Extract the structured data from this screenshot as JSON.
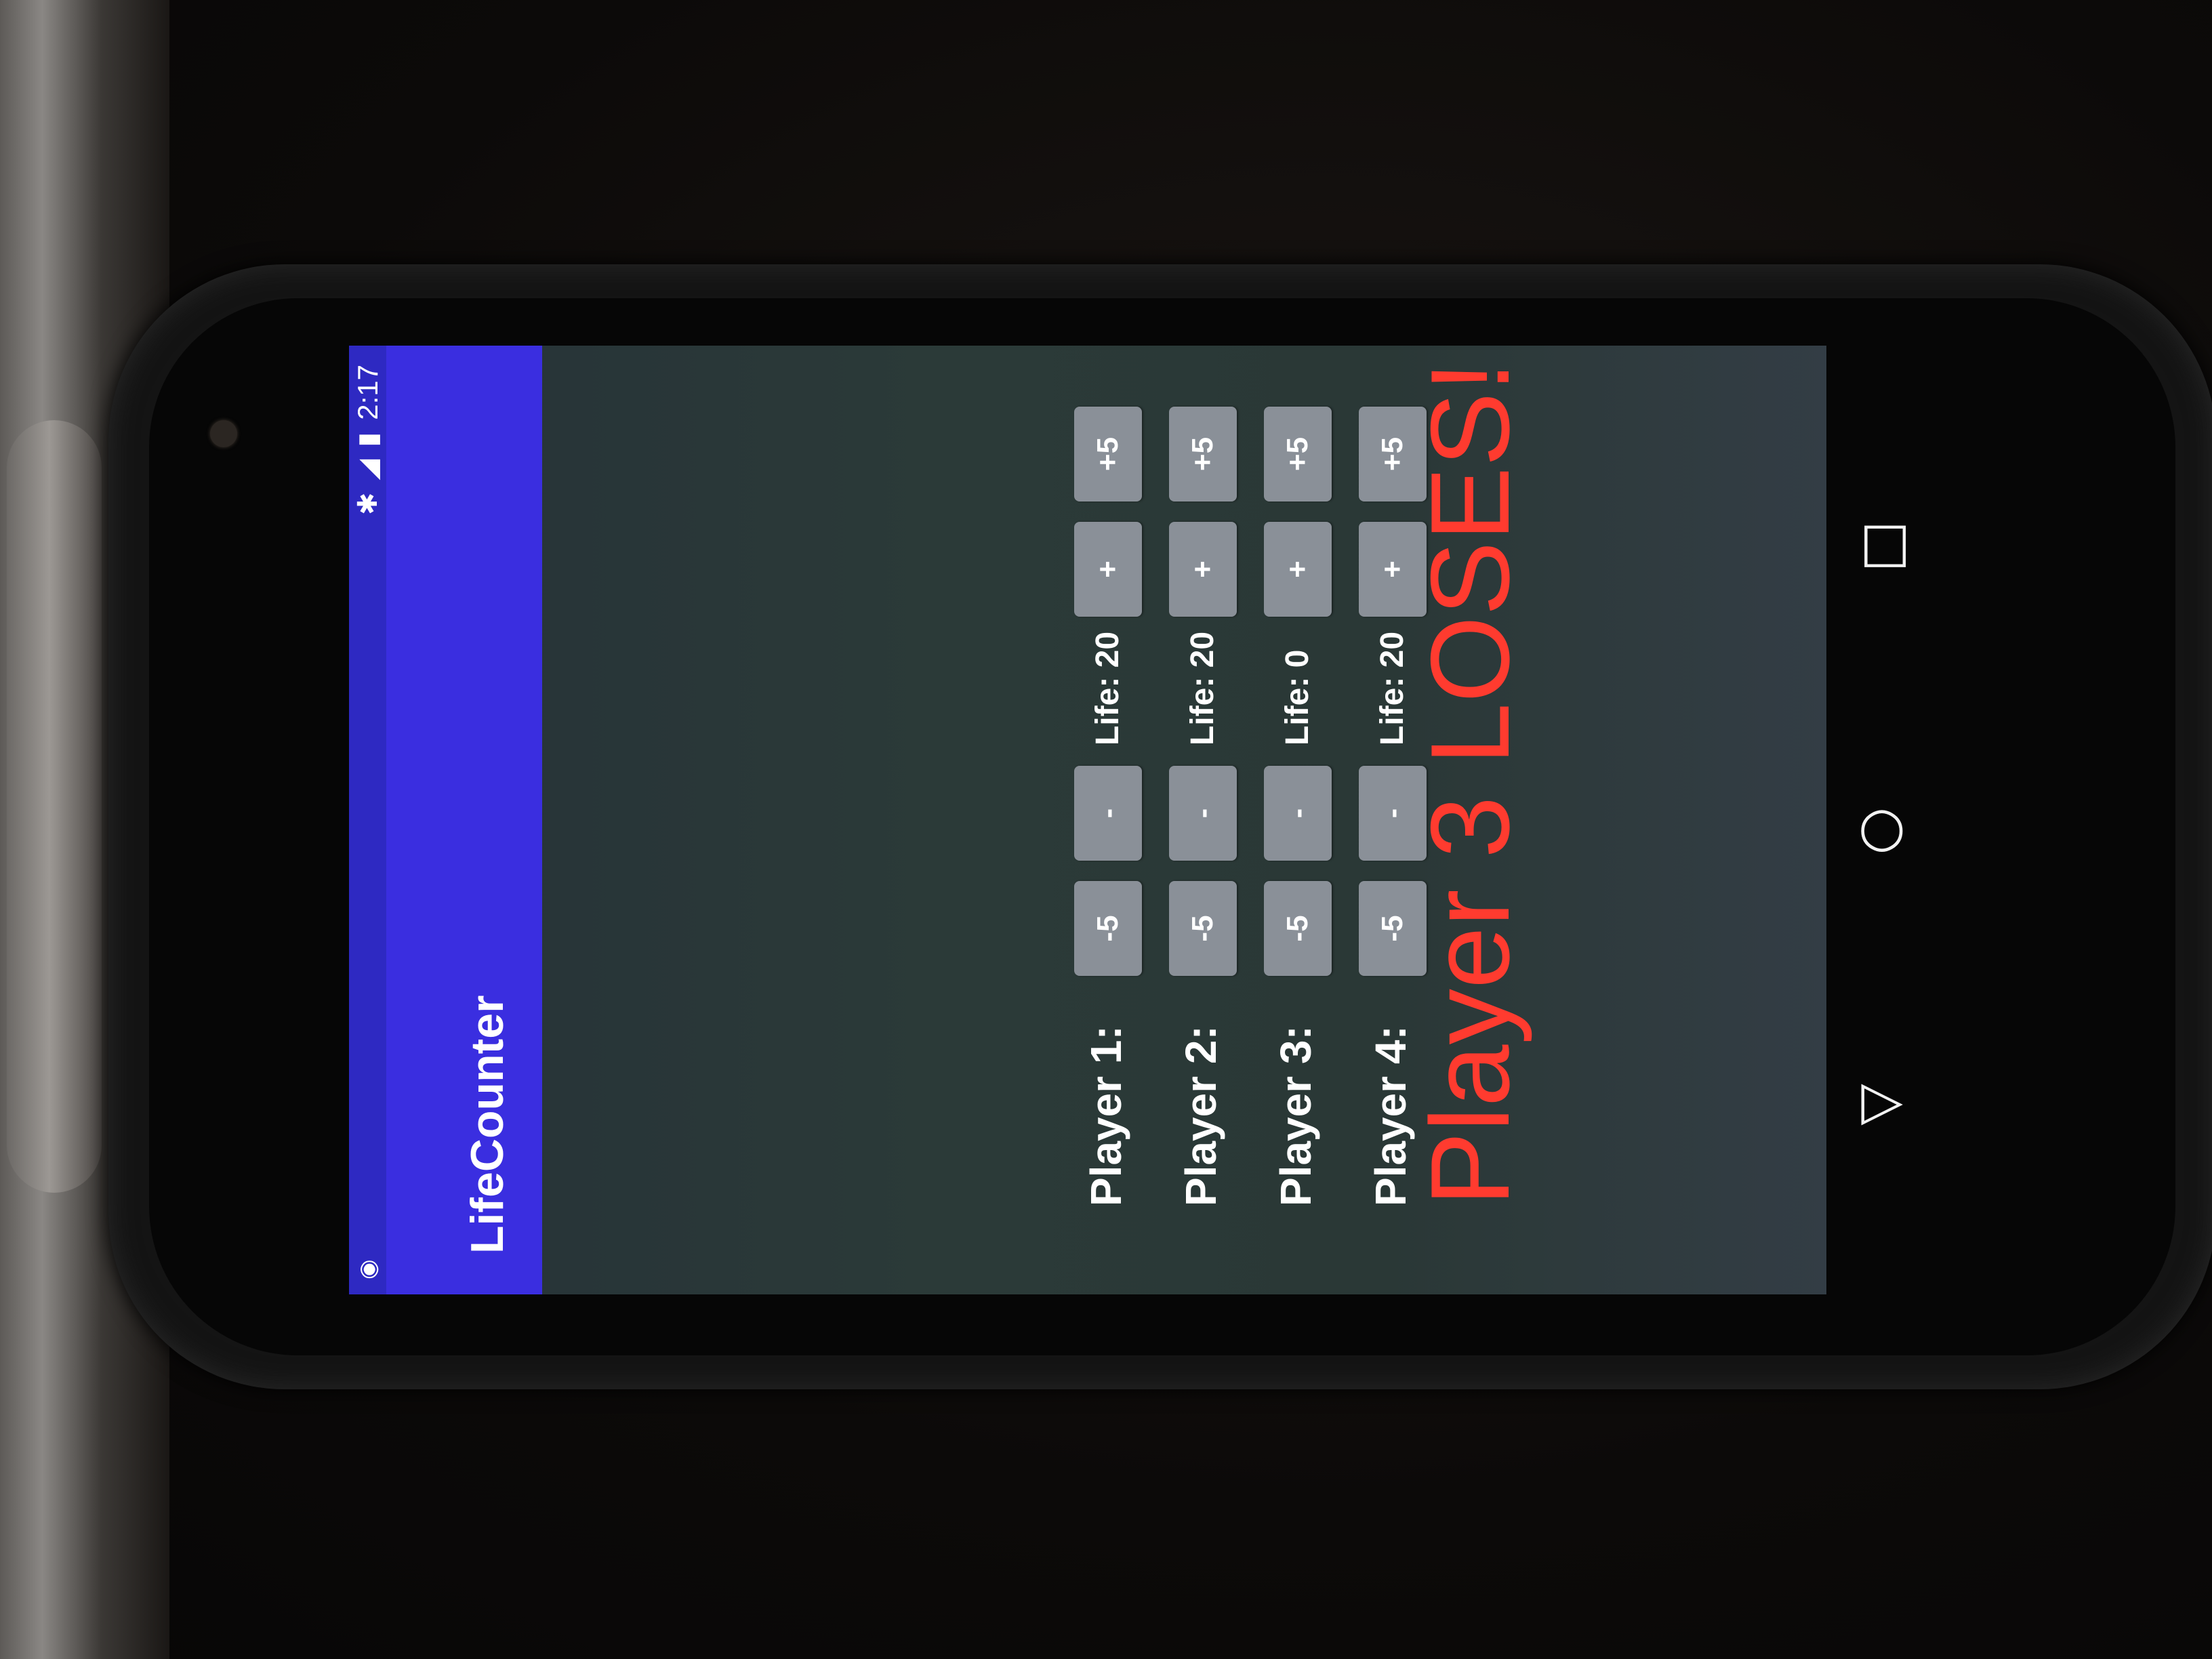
{
  "status_bar": {
    "notification_icon": "android-debug-icon",
    "bluetooth_icon": "bluetooth-icon",
    "signal_icon": "signal-icon",
    "battery_icon": "battery-charging-icon",
    "time": "2:17"
  },
  "app": {
    "title": "LifeCounter",
    "accent_color": "#3a2ee0",
    "lose_color": "#ff3b2f"
  },
  "players": [
    {
      "label": "Player 1:",
      "minus5": "-5",
      "minus1": "-",
      "life": "Life: 20",
      "plus1": "+",
      "plus5": "+5"
    },
    {
      "label": "Player 2:",
      "minus5": "-5",
      "minus1": "-",
      "life": "Life: 20",
      "plus1": "+",
      "plus5": "+5"
    },
    {
      "label": "Player 3:",
      "minus5": "-5",
      "minus1": "-",
      "life": "Life: 0",
      "plus1": "+",
      "plus5": "+5"
    },
    {
      "label": "Player 4:",
      "minus5": "-5",
      "minus1": "-",
      "life": "Life: 20",
      "plus1": "+",
      "plus5": "+5"
    }
  ],
  "lose_message": "Player 3 LOSES!",
  "nav_bar": {
    "back_icon": "back-triangle-icon",
    "home_icon": "home-circle-icon",
    "recents_icon": "recents-square-icon"
  }
}
